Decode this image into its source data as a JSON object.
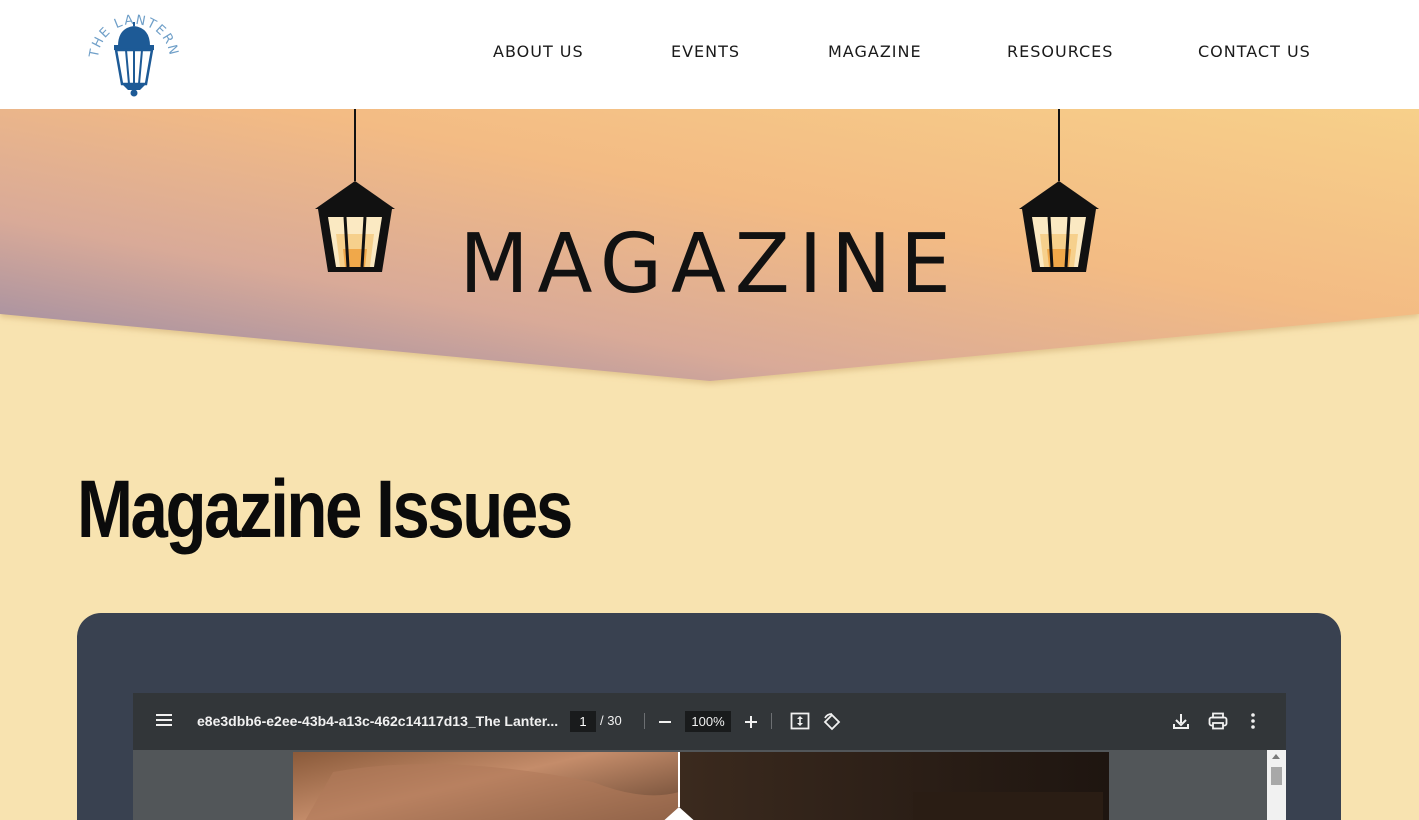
{
  "header": {
    "logo_text": "THE LANTERN",
    "nav": [
      "ABOUT US",
      "EVENTS",
      "MAGAZINE",
      "RESOURCES",
      "CONTACT US"
    ]
  },
  "hero": {
    "title": "MAGAZINE"
  },
  "section": {
    "title": "Magazine Issues"
  },
  "pdf_viewer": {
    "filename": "e8e3dbb6-e2ee-43b4-a13c-462c14117d13_The Lanter...",
    "current_page": "1",
    "total_pages": "/ 30",
    "zoom": "100%",
    "icons": [
      "menu-icon",
      "zoom-out-icon",
      "zoom-in-icon",
      "fit-page-icon",
      "rotate-icon",
      "download-icon",
      "print-icon",
      "more-options-icon"
    ]
  },
  "colors": {
    "header_bg": "#ffffff",
    "page_bg": "#f8e3b0",
    "logo_blue": "#1d5a96",
    "card_bg": "#394150",
    "toolbar_bg": "#323639"
  }
}
